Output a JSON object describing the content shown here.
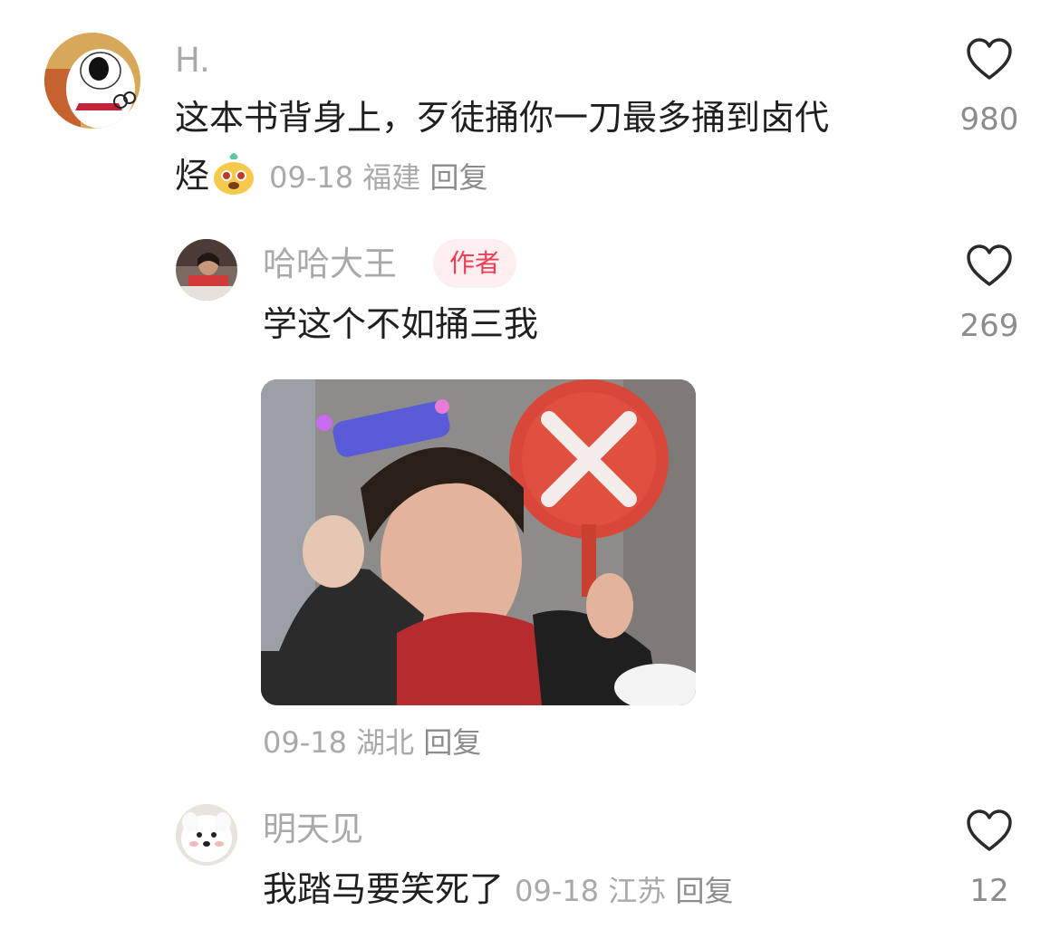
{
  "comments": [
    {
      "username": "H.",
      "text_line1": "这本书背身上，歹徒捅你一刀最多捅到卤代",
      "text_line2": "烃",
      "sticker_icon": "cute-face-sticker",
      "date": "09-18",
      "location": "福建",
      "reply_label": "回复",
      "likes": "980"
    },
    {
      "username": "哈哈大王",
      "author_tag": "作者",
      "text": "学这个不如捅三我",
      "has_image": true,
      "date": "09-18",
      "location": "湖北",
      "reply_label": "回复",
      "likes": "269"
    },
    {
      "username": "明天见",
      "text": "我踏马要笑死了",
      "date": "09-18",
      "location": "江苏",
      "reply_label": "回复",
      "likes": "12"
    }
  ],
  "colors": {
    "username": "#a9a9a9",
    "text": "#1f1f1f",
    "author_tag_bg": "#fdeef0",
    "author_tag_text": "#f23c55"
  }
}
